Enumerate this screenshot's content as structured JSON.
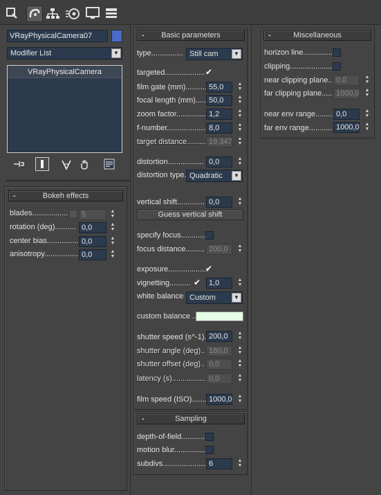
{
  "colors": {
    "bg": "#444444",
    "spinner": "#2b3a4d",
    "accent_swatch": "#4a6cc8",
    "custom_balance": "#e6fde6"
  },
  "command_panel": {
    "tabs": [
      "create-tab",
      "modify-tab",
      "hierarchy-tab",
      "motion-tab",
      "display-tab",
      "utilities-tab"
    ],
    "object_name": "VRayPhysicalCamera07",
    "modifier_list": "Modifier List",
    "stack_item": "VRayPhysicalCamera",
    "stack_tools": [
      "pin-stack-icon",
      "show-end-result-icon",
      "make-unique-icon",
      "remove-modifier-icon",
      "configure-modifier-sets-icon"
    ]
  },
  "bokeh": {
    "title": "Bokeh effects",
    "blades_label": "blades.................",
    "blades_value": "5",
    "rotation_label": "rotation (deg)..........",
    "rotation_value": "0,0",
    "center_bias_label": "center bias.................",
    "center_bias_value": "0,0",
    "anisotropy_label": "anisotropy.................",
    "anisotropy_value": "0,0"
  },
  "basic": {
    "title": "Basic parameters",
    "type_label": "type...............",
    "type_value": "Still cam",
    "targeted_label": "targeted...................",
    "film_gate_label": "film gate (mm)..........",
    "film_gate_value": "55,0",
    "focal_label": "focal length (mm).....",
    "focal_value": "50,0",
    "zoom_label": "zoom factor...............",
    "zoom_value": "1,2",
    "fnumber_label": "f-number....................",
    "fnumber_value": "8,0",
    "target_dist_label": "target distance.........",
    "target_dist_value": "19,347",
    "distortion_label": "distortion.................",
    "distortion_value": "0,0",
    "distortion_type_label": "distortion type.",
    "distortion_type_value": "Quadratic",
    "vshift_label": "vertical shift.............",
    "vshift_value": "0,0",
    "guess_button": "Guess vertical shift",
    "specify_focus_label": "specify focus............",
    "focus_dist_label": "focus distance.........",
    "focus_dist_value": "200,0",
    "exposure_label": "exposure...................",
    "vignetting_label": "vignetting..........",
    "vignetting_value": "1,0",
    "white_balance_label": "white balance",
    "white_balance_value": "Custom",
    "custom_balance_label": "custom balance ......",
    "shutter_speed_label": "shutter speed (s^-1).",
    "shutter_speed_value": "200,0",
    "shutter_angle_label": "shutter angle (deg)..",
    "shutter_angle_value": "180,0",
    "shutter_offset_label": "shutter offset (deg)..",
    "shutter_offset_value": "0,0",
    "latency_label": "latency (s)...................",
    "latency_value": "0,0",
    "film_speed_label": "film speed (ISO).......",
    "film_speed_value": "1000,0"
  },
  "sampling": {
    "title": "Sampling",
    "dof_label": "depth-of-field............",
    "motion_blur_label": "motion blur.................",
    "subdivs_label": "subdivs......................",
    "subdivs_value": "6"
  },
  "misc": {
    "title": "Miscellaneous",
    "horizon_label": "horizon line..............",
    "clipping_label": "clipping......................",
    "near_clip_label": "near clipping plane..",
    "near_clip_value": "0,0",
    "far_clip_label": "far clipping plane.....",
    "far_clip_value": "1000,0",
    "near_env_label": "near env range..........",
    "near_env_value": "0,0",
    "far_env_label": "far env range...........",
    "far_env_value": "1000,0"
  }
}
